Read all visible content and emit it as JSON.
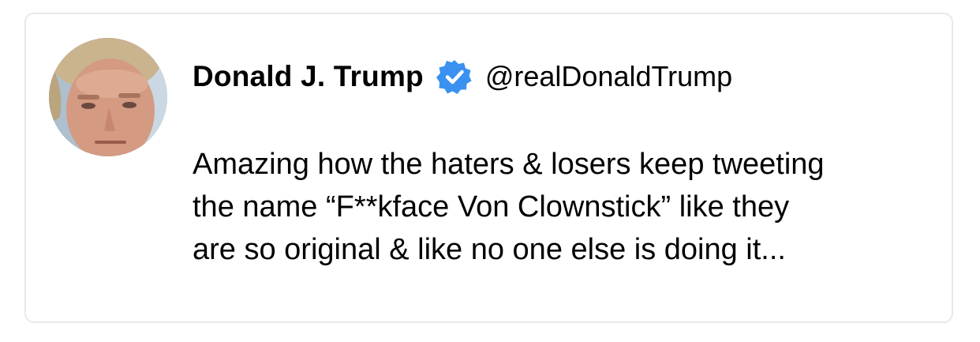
{
  "tweet": {
    "display_name": "Donald J. Trump",
    "handle": "@realDonaldTrump",
    "verified": true,
    "text": "Amazing how the haters & losers keep tweeting\nthe name “F**kface Von Clownstick” like they\nare so original & like no one else is doing it..."
  },
  "icons": {
    "avatar": "profile-photo",
    "verified": "verified-badge-icon"
  },
  "colors": {
    "verified_badge": "#3a91f0",
    "card_border": "#e6e8ea",
    "text": "#000000"
  }
}
